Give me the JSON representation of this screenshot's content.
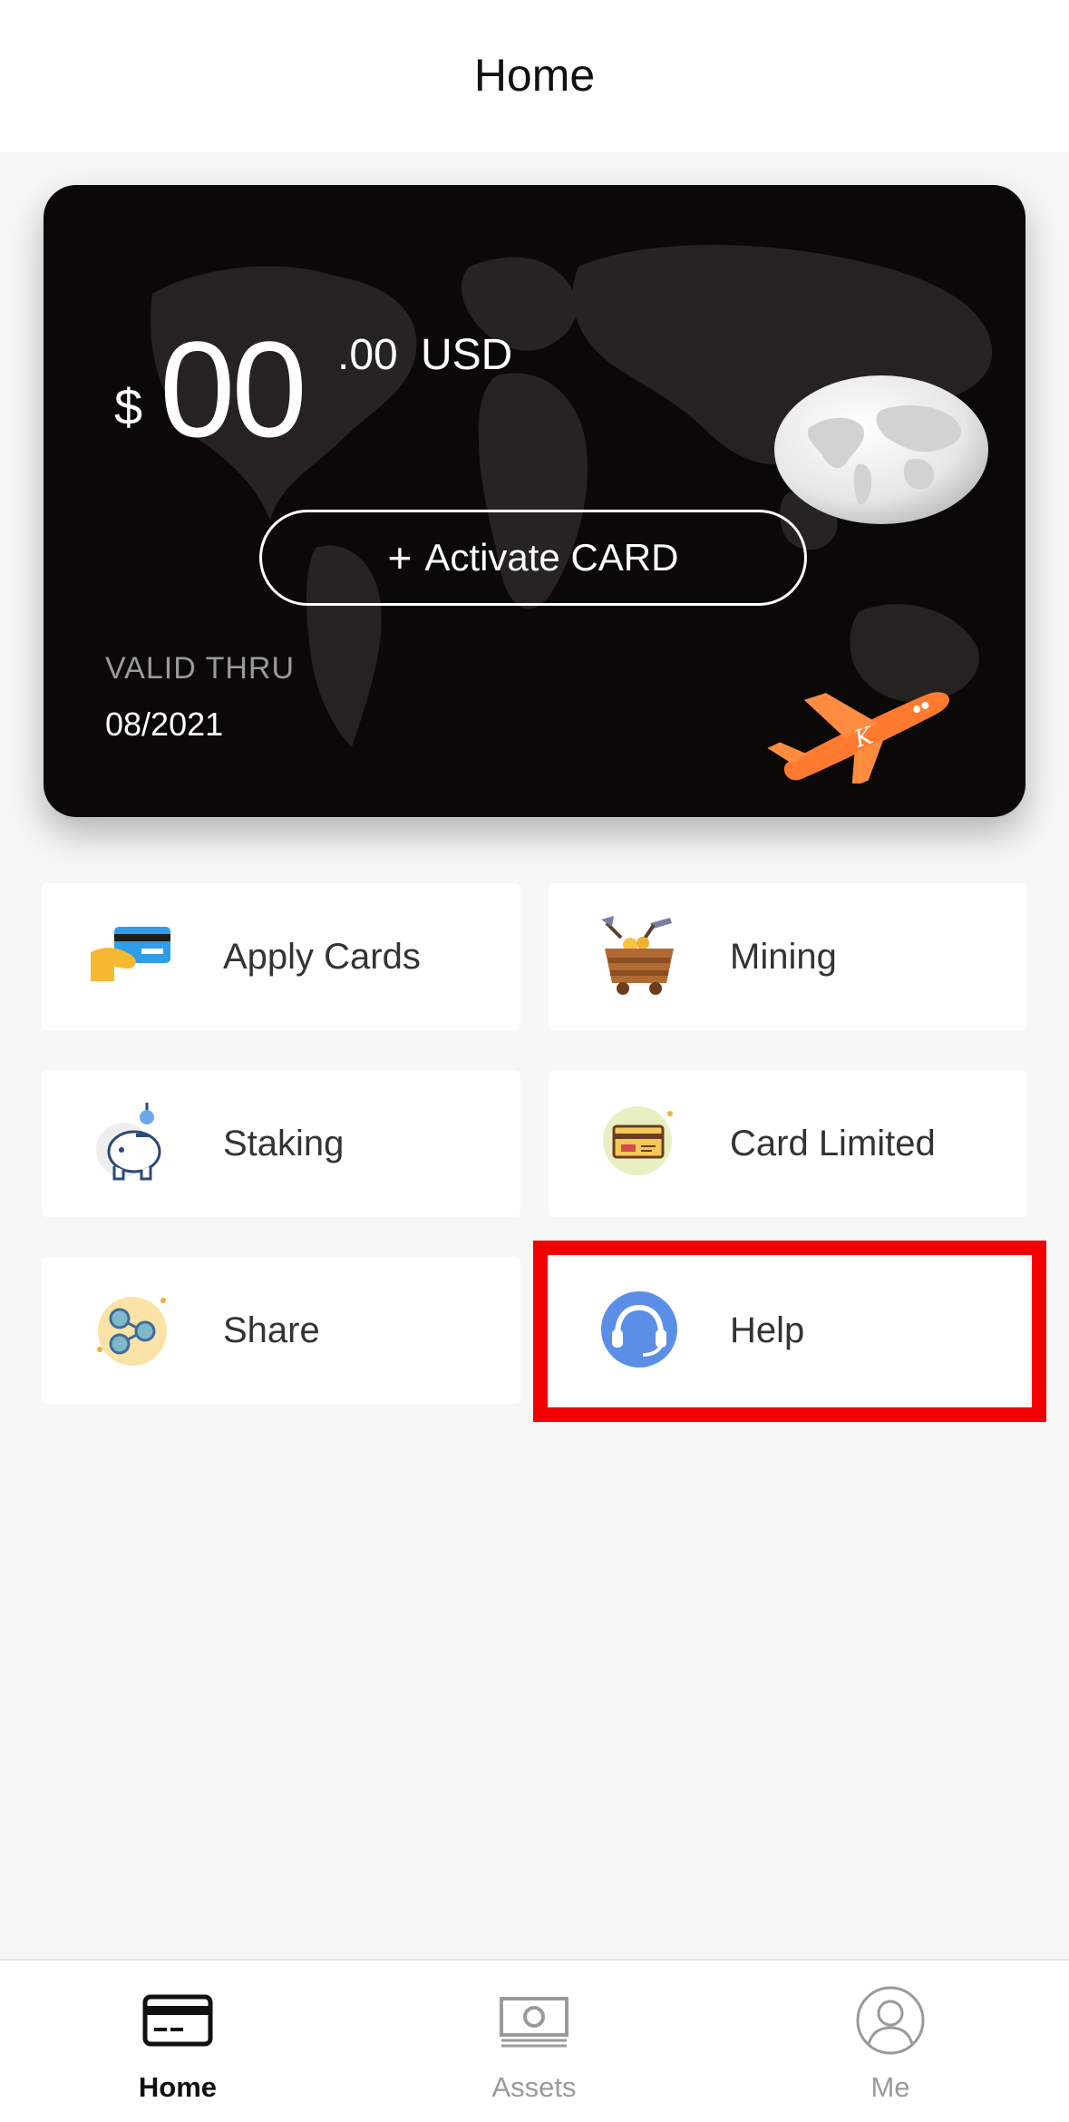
{
  "header": {
    "title": "Home"
  },
  "card": {
    "currency_symbol": "$",
    "balance_whole": "00",
    "balance_decimal": ".00",
    "currency_code": "USD",
    "activate_label": "Activate CARD",
    "activate_plus": "+",
    "valid_label": "VALID THRU",
    "valid_date": "08/2021",
    "colors": {
      "background": "#0b0808",
      "plane": "#ff7a2e"
    }
  },
  "menu": {
    "items": [
      {
        "label": "Apply Cards",
        "icon": "card-in-hand-icon"
      },
      {
        "label": "Mining",
        "icon": "mining-cart-icon"
      },
      {
        "label": "Staking",
        "icon": "piggy-bank-icon"
      },
      {
        "label": "Card Limited",
        "icon": "card-limited-icon"
      },
      {
        "label": "Share",
        "icon": "share-icon"
      },
      {
        "label": "Help",
        "icon": "headset-icon"
      }
    ]
  },
  "highlight_color": "#f20000",
  "tabbar": {
    "tabs": [
      {
        "label": "Home",
        "icon": "card-icon",
        "active": true
      },
      {
        "label": "Assets",
        "icon": "banknote-icon",
        "active": false
      },
      {
        "label": "Me",
        "icon": "user-icon",
        "active": false
      }
    ]
  }
}
